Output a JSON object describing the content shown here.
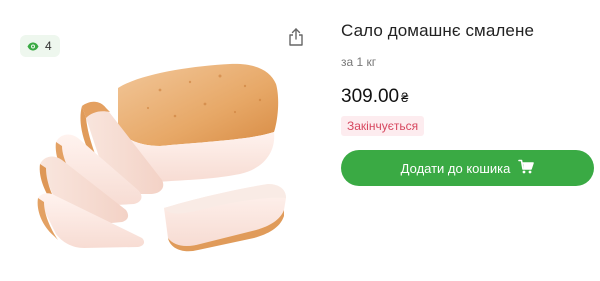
{
  "product": {
    "views_count": "4",
    "title": "Сало домашнє смалене",
    "unit": "за 1 кг",
    "price": "309.00",
    "currency": "₴",
    "status": "Закінчується",
    "add_to_cart_label": "Додати до кошика"
  },
  "icons": {
    "views": "eye-icon",
    "share": "share-icon",
    "cart": "cart-icon"
  },
  "colors": {
    "accent_green": "#3aaa44",
    "views_badge_bg": "#eef7ee",
    "status_text": "#d7475f",
    "status_bg": "#fdecef"
  }
}
